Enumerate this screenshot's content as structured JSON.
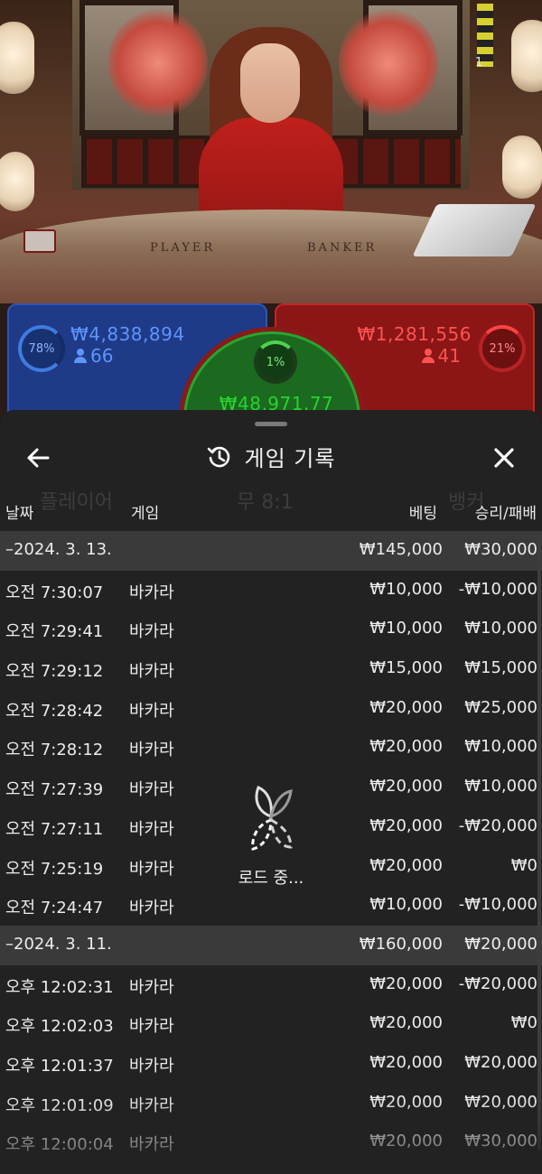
{
  "video": {
    "table_player_label": "PLAYER",
    "table_banker_label": "BANKER",
    "indicator": "1"
  },
  "bets": {
    "player": {
      "percent": "78%",
      "amount": "₩4,838,894",
      "users": "66"
    },
    "tie": {
      "percent": "1%",
      "amount": "₩48,971.77"
    },
    "banker": {
      "percent": "21%",
      "amount": "₩1,281,556",
      "users": "41"
    }
  },
  "sheet": {
    "title": "게임 기록",
    "background_ghost": {
      "player": "플레이어",
      "tie": "무 8:1",
      "banker": "뱅커"
    },
    "columns": {
      "date": "날짜",
      "game": "게임",
      "bet": "베팅",
      "result": "승리/패배"
    },
    "rows": [
      {
        "group": true,
        "date": "–2024. 3. 13.",
        "game": "",
        "bet": "₩145,000",
        "result": "₩30,000"
      },
      {
        "group": false,
        "date": "오전 7:30:07",
        "game": "바카라",
        "bet": "₩10,000",
        "result": "-₩10,000"
      },
      {
        "group": false,
        "date": "오전 7:29:41",
        "game": "바카라",
        "bet": "₩10,000",
        "result": "₩10,000"
      },
      {
        "group": false,
        "date": "오전 7:29:12",
        "game": "바카라",
        "bet": "₩15,000",
        "result": "₩15,000"
      },
      {
        "group": false,
        "date": "오전 7:28:42",
        "game": "바카라",
        "bet": "₩20,000",
        "result": "₩25,000"
      },
      {
        "group": false,
        "date": "오전 7:28:12",
        "game": "바카라",
        "bet": "₩20,000",
        "result": "₩10,000"
      },
      {
        "group": false,
        "date": "오전 7:27:39",
        "game": "바카라",
        "bet": "₩20,000",
        "result": "₩10,000"
      },
      {
        "group": false,
        "date": "오전 7:27:11",
        "game": "바카라",
        "bet": "₩20,000",
        "result": "-₩20,000"
      },
      {
        "group": false,
        "date": "오전 7:25:19",
        "game": "바카라",
        "bet": "₩20,000",
        "result": "₩0"
      },
      {
        "group": false,
        "date": "오전 7:24:47",
        "game": "바카라",
        "bet": "₩10,000",
        "result": "-₩10,000"
      },
      {
        "group": true,
        "date": "–2024. 3. 11.",
        "game": "",
        "bet": "₩160,000",
        "result": "₩20,000"
      },
      {
        "group": false,
        "date": "오후 12:02:31",
        "game": "바카라",
        "bet": "₩20,000",
        "result": "-₩20,000"
      },
      {
        "group": false,
        "date": "오후 12:02:03",
        "game": "바카라",
        "bet": "₩20,000",
        "result": "₩0"
      },
      {
        "group": false,
        "date": "오후 12:01:37",
        "game": "바카라",
        "bet": "₩20,000",
        "result": "₩20,000"
      },
      {
        "group": false,
        "date": "오후 12:01:09",
        "game": "바카라",
        "bet": "₩20,000",
        "result": "₩20,000"
      },
      {
        "group": false,
        "date": "오후 12:00:04",
        "game": "바카라",
        "bet": "₩20,000",
        "result": "₩30,000"
      }
    ],
    "loading_text": "로드 중..."
  },
  "icons": {
    "back": "arrow-left-icon",
    "close": "close-icon",
    "history": "history-icon",
    "loader": "spinner-icon",
    "user": "user-icon"
  },
  "colors": {
    "player": "#1f3a86",
    "banker": "#8c1616",
    "tie": "#1b6a1f",
    "sheet_bg": "#222222",
    "group_row_bg": "#3a3a3a"
  }
}
